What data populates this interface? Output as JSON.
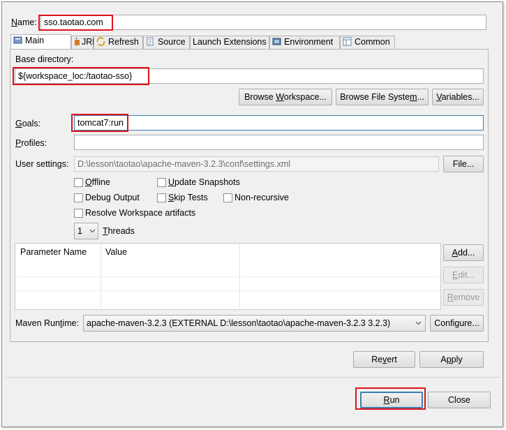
{
  "name": {
    "label": "Name:",
    "value": "sso.taotao.com"
  },
  "tabs": [
    {
      "label": "Main",
      "icon": "maven-main-icon"
    },
    {
      "label": "JRE",
      "icon": "jre-icon"
    },
    {
      "label": "Refresh",
      "icon": "refresh-icon"
    },
    {
      "label": "Source",
      "icon": "source-icon"
    },
    {
      "label": "Launch Extensions",
      "icon": ""
    },
    {
      "label": "Environment",
      "icon": "environment-icon"
    },
    {
      "label": "Common",
      "icon": "common-icon"
    }
  ],
  "base_directory": {
    "label": "Base directory:",
    "value": "${workspace_loc:/taotao-sso}",
    "browse_workspace": "Browse Workspace...",
    "browse_file_system": "Browse File System...",
    "variables": "Variables..."
  },
  "goals": {
    "label": "Goals:",
    "value": "tomcat7:run"
  },
  "profiles": {
    "label": "Profiles:",
    "value": ""
  },
  "user_settings": {
    "label": "User settings:",
    "value": "D:\\lesson\\taotao\\apache-maven-3.2.3\\conf\\settings.xml",
    "file_button": "File..."
  },
  "options": {
    "offline": "Offline",
    "update_snapshots": "Update Snapshots",
    "debug_output": "Debug Output",
    "skip_tests": "Skip Tests",
    "non_recursive": "Non-recursive",
    "resolve_workspace": "Resolve Workspace artifacts"
  },
  "threads": {
    "value": "1",
    "label": "Threads"
  },
  "parameters": {
    "columns": [
      "Parameter Name",
      "Value"
    ],
    "add": "Add...",
    "edit": "Edit...",
    "remove": "Remove"
  },
  "maven_runtime": {
    "label": "Maven Runtime:",
    "value": "apache-maven-3.2.3 (EXTERNAL D:\\lesson\\taotao\\apache-maven-3.2.3 3.2.3)",
    "configure": "Configure..."
  },
  "footer": {
    "revert": "Revert",
    "apply": "Apply",
    "run": "Run",
    "close": "Close"
  },
  "colors": {
    "highlight": "#e0121b",
    "focus": "#3c7fb1"
  }
}
